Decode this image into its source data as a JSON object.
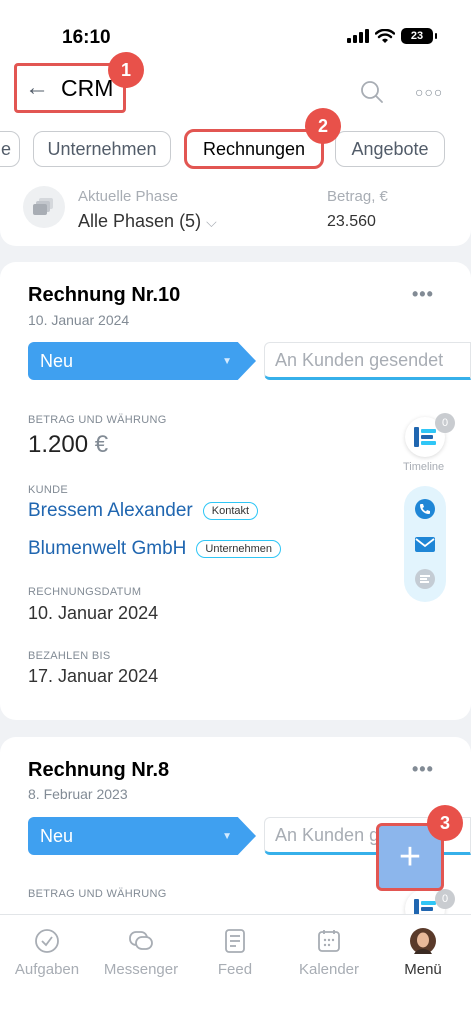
{
  "status_bar": {
    "time": "16:10",
    "battery": "23"
  },
  "header": {
    "back_icon": "arrow-left-icon",
    "title": "CRM",
    "search_icon": "search-icon",
    "more_icon": "more-horizontal-icon"
  },
  "annotations": {
    "badge1": "1",
    "badge2": "2",
    "badge3": "3"
  },
  "tabs": [
    {
      "label": "e"
    },
    {
      "label": "Unternehmen"
    },
    {
      "label": "Rechnungen"
    },
    {
      "label": "Angebote"
    }
  ],
  "phase": {
    "label": "Aktuelle Phase",
    "value": "Alle Phasen (5)",
    "amount_label": "Betrag, €",
    "amount_value": "23.560"
  },
  "cards": [
    {
      "title": "Rechnung Nr.10",
      "date": "10. Januar 2024",
      "stage_current": "Neu",
      "stage_next": "An Kunden gesendet",
      "amount_label": "BETRAG UND WÄHRUNG",
      "amount": "1.200",
      "currency": "€",
      "customer_label": "KUNDE",
      "customer_contact": "Bressem Alexander",
      "contact_pill": "Kontakt",
      "customer_company": "Blumenwelt GmbH",
      "company_pill": "Unternehmen",
      "invoice_date_label": "RECHNUNGSDATUM",
      "invoice_date": "10. Januar 2024",
      "due_label": "BEZAHLEN BIS",
      "due_date": "17. Januar 2024",
      "timeline_label": "Timeline",
      "timeline_count": "0"
    },
    {
      "title": "Rechnung Nr.8",
      "date": "8. Februar 2023",
      "stage_current": "Neu",
      "stage_next": "An Kunden gesendet",
      "amount_label": "BETRAG UND WÄHRUNG",
      "timeline_count": "0"
    }
  ],
  "fab": {
    "icon": "plus-icon"
  },
  "nav": [
    {
      "label": "Aufgaben",
      "icon": "check-circle-icon"
    },
    {
      "label": "Messenger",
      "icon": "chat-icon"
    },
    {
      "label": "Feed",
      "icon": "feed-icon"
    },
    {
      "label": "Kalender",
      "icon": "calendar-icon"
    },
    {
      "label": "Menü",
      "icon": "avatar"
    }
  ],
  "colors": {
    "accent": "#3fa0f0",
    "link": "#2066b0",
    "annotation": "#e25652"
  }
}
